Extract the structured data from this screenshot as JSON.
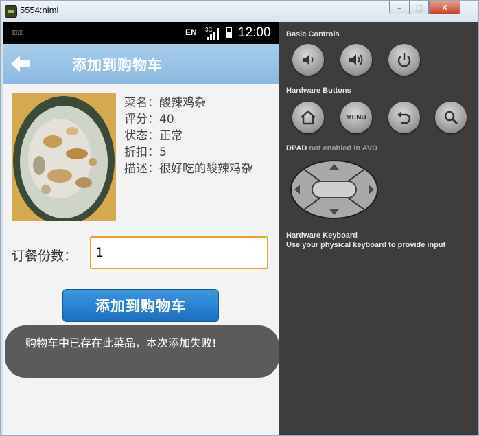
{
  "window": {
    "title": "5554:nimi",
    "controls": {
      "minimize": "–",
      "maximize": "□",
      "close": "✕"
    }
  },
  "statusbar": {
    "lang": "EN",
    "network": "3G",
    "time": "12:00"
  },
  "actionbar": {
    "title": "添加到购物车",
    "back_icon": "arrow-left-icon"
  },
  "dish": {
    "name_line": "菜名：酸辣鸡杂",
    "rating_line": "评分：40",
    "status_line": "状态：正常",
    "discount_line": "折扣：5",
    "desc_line": "描述：很好吃的酸辣鸡杂"
  },
  "order": {
    "qty_label": "订餐份数：",
    "qty_value": "1"
  },
  "add_button": {
    "label": "添加到购物车"
  },
  "toast": {
    "message": "购物车中已存在此菜品，本次添加失败!"
  },
  "panel": {
    "basic_controls": "Basic Controls",
    "hardware_buttons": "Hardware Buttons",
    "dpad_title": "DPAD",
    "dpad_note": "not enabled in AVD",
    "keyboard_title": "Hardware Keyboard",
    "keyboard_note": "Use your physical keyboard to provide input",
    "menu_label": "MENU"
  },
  "colors": {
    "actionbar": "#8ab9df",
    "button": "#1a6ec2",
    "input_border": "#f0a030",
    "panel_bg": "#3d3d3d",
    "toast_bg": "#5b5b5b"
  }
}
